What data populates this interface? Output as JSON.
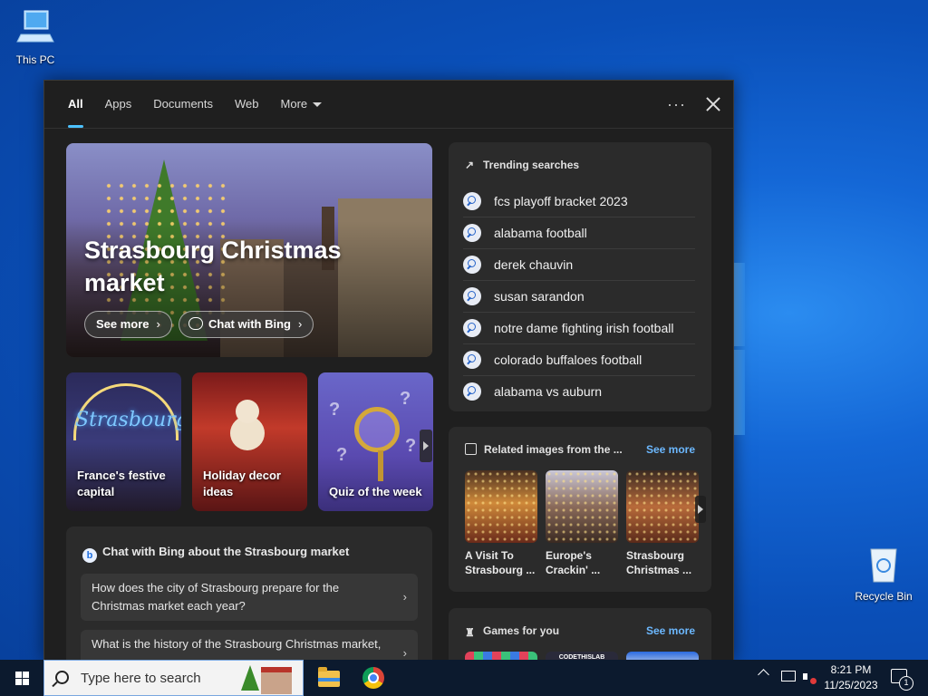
{
  "desktop": {
    "this_pc_label": "This PC",
    "recycle_bin_label": "Recycle Bin"
  },
  "tabs": [
    {
      "label": "All",
      "active": true
    },
    {
      "label": "Apps"
    },
    {
      "label": "Documents"
    },
    {
      "label": "Web"
    },
    {
      "label": "More"
    }
  ],
  "header_actions": {
    "more_options": "···"
  },
  "hero": {
    "title": "Strasbourg Christmas market",
    "see_more": "See more",
    "chat_with_bing": "Chat with Bing"
  },
  "tiles": [
    {
      "caption": "France's festive capital",
      "neon": "Strasbourg"
    },
    {
      "caption": "Holiday decor ideas"
    },
    {
      "caption": "Quiz of the week"
    }
  ],
  "chat": {
    "heading": "Chat with Bing about the Strasbourg market",
    "questions": [
      "How does the city of Strasbourg prepare for the Christmas market each year?",
      "What is the history of the Strasbourg Christmas market,"
    ]
  },
  "trending": {
    "heading": "Trending searches",
    "items": [
      "fcs playoff bracket 2023",
      "alabama football",
      "derek chauvin",
      "susan sarandon",
      "notre dame fighting irish football",
      "colorado buffaloes football",
      "alabama vs auburn"
    ]
  },
  "related": {
    "heading": "Related images from the ...",
    "see_more": "See more",
    "items": [
      {
        "caption": "A Visit To Strasbourg ..."
      },
      {
        "caption": "Europe's Crackin' ..."
      },
      {
        "caption": "Strasbourg Christmas ..."
      }
    ]
  },
  "games": {
    "heading": "Games for you",
    "see_more": "See more",
    "thumb2_text": "CODETHISLAB"
  },
  "taskbar": {
    "search_placeholder": "Type here to search",
    "time": "8:21 PM",
    "date": "11/25/2023",
    "notification_count": "1"
  }
}
